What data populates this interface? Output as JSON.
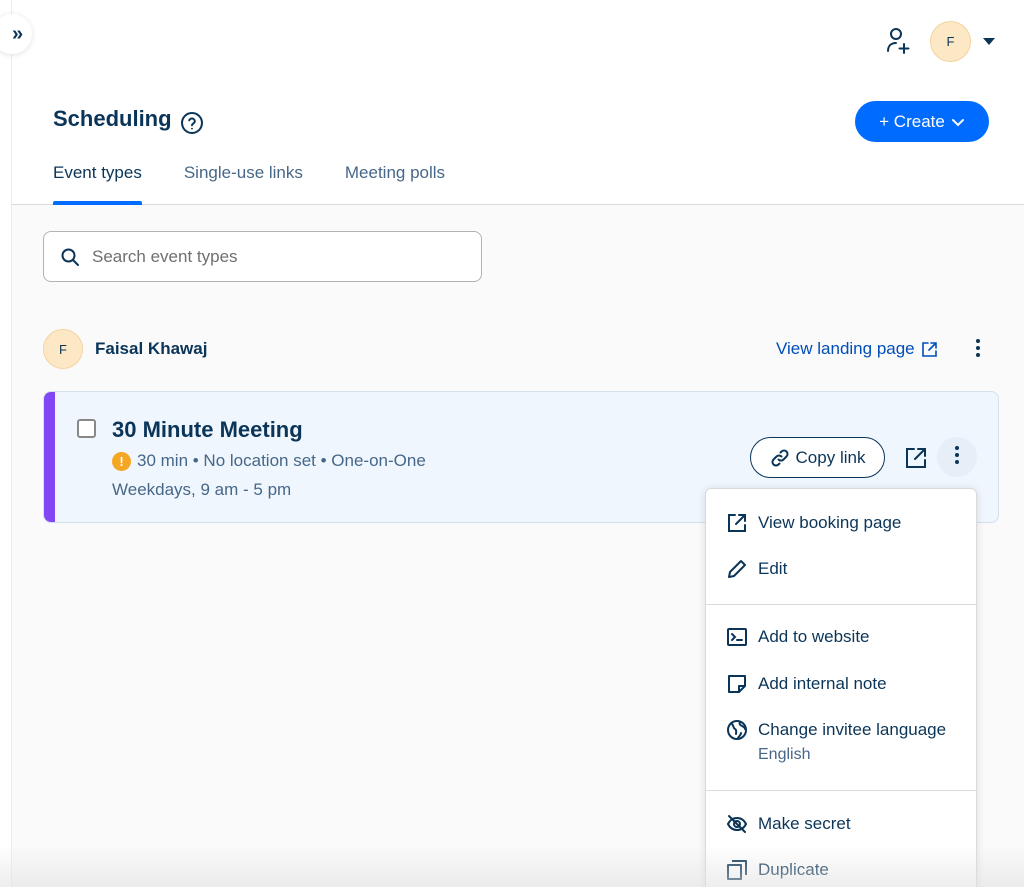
{
  "header": {
    "page_title": "Scheduling",
    "avatar_initial": "F",
    "create_label": "+ Create",
    "tabs": [
      {
        "label": "Event types",
        "active": true
      },
      {
        "label": "Single-use links",
        "active": false
      },
      {
        "label": "Meeting polls",
        "active": false
      }
    ]
  },
  "search": {
    "placeholder": "Search event types",
    "value": ""
  },
  "user": {
    "initial": "F",
    "name": "Faisal Khawaj",
    "landing_link": "View landing page"
  },
  "event": {
    "title": "30 Minute Meeting",
    "meta": "30 min • No location set • One-on-One",
    "schedule": "Weekdays, 9 am - 5 pm",
    "copy_link": "Copy link",
    "accent_color": "#8247f5"
  },
  "menu": {
    "view_booking": "View booking page",
    "edit": "Edit",
    "add_to_website": "Add to website",
    "add_note": "Add internal note",
    "change_language": "Change invitee language",
    "language_value": "English",
    "make_secret": "Make secret",
    "duplicate": "Duplicate"
  },
  "colors": {
    "brand_blue": "#006bff",
    "text_dark": "#0b3558",
    "link_blue": "#004eba",
    "warning": "#f5a623"
  },
  "icons": [
    "expand-sidebar-icon",
    "add-person-icon",
    "help-icon",
    "search-icon",
    "external-link-icon",
    "link-icon",
    "warning-icon",
    "pencil-icon",
    "embed-code-icon",
    "note-icon",
    "globe-language-icon",
    "eye-off-icon",
    "duplicate-icon"
  ]
}
